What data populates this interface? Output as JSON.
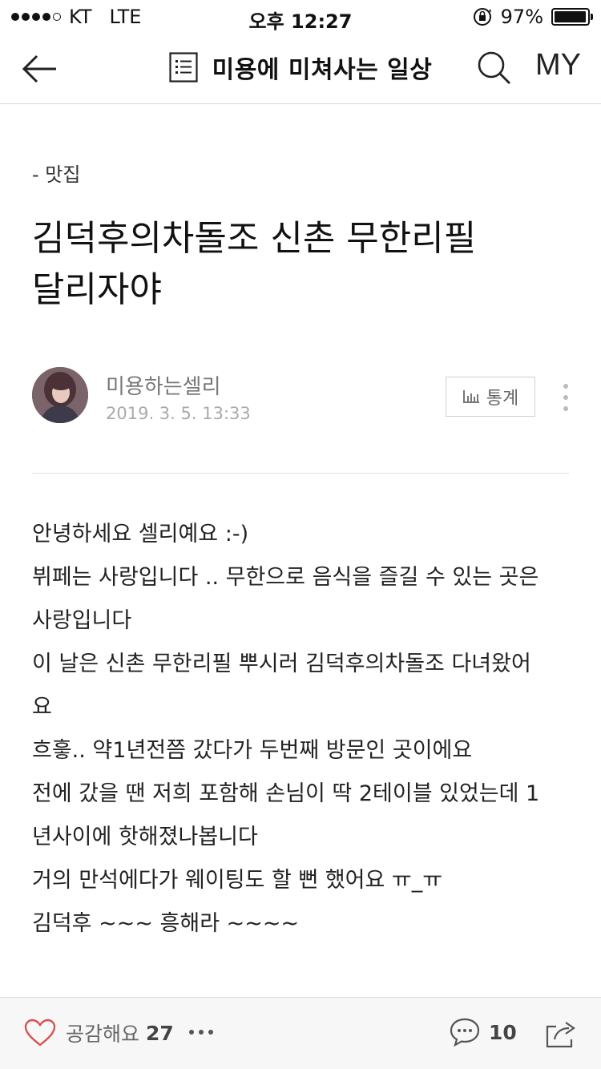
{
  "status_bar": {
    "carrier": "KT",
    "network": "LTE",
    "time": "오후 12:27",
    "battery_percent": "97%",
    "battery_level": 0.97
  },
  "nav": {
    "blog_title": "미용에 미쳐사는 일상",
    "my_label": "MY",
    "icons": [
      "back-arrow-icon",
      "document-list-icon",
      "search-icon"
    ]
  },
  "post": {
    "category": "- 맛집",
    "title_line1": "김덕후의차돌조 신촌 무한리필",
    "title_line2": "달리자야",
    "author": "미용하는셀리",
    "date": "2019. 3. 5. 13:33",
    "stats_label": "통계",
    "body": [
      "안녕하세요 셀리예요 :-)",
      "뷔페는 사랑입니다 .. 무한으로 음식을 즐길 수 있는 곳은",
      "사랑입니다",
      "이 날은 신촌 무한리필 뿌시러 김덕후의차돌조 다녀왔어",
      "요",
      "흐흫.. 약1년전쯤 갔다가 두번째 방문인 곳이에요",
      "전에 갔을 땐 저희 포함해 손님이 딱 2테이블 있었는데 1",
      "년사이에 핫해졌나봅니다",
      "거의 만석에다가 웨이팅도 할 뻔 했어요 ㅠ_ㅠ",
      "김덕후 ~~~ 흥해라 ~~~~"
    ]
  },
  "bottom_bar": {
    "like_label": "공감해요",
    "like_count": "27",
    "comment_count": "10",
    "icons": [
      "heart-icon",
      "more-horizontal-icon",
      "comment-icon",
      "share-icon"
    ]
  },
  "colors": {
    "accent_heart": "#d9534f",
    "text_primary": "#222222",
    "text_secondary": "#777777",
    "bottom_bar_bg": "#f7f7f7"
  }
}
